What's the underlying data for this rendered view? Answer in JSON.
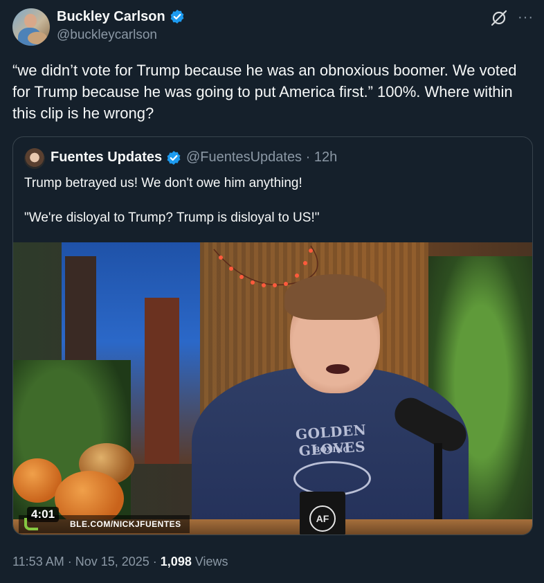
{
  "author": {
    "name": "Buckley Carlson",
    "handle": "@buckleycarlson",
    "verified": true
  },
  "icons": {
    "verified": "verified-badge-icon",
    "grok": "grok-icon",
    "more": "more-options-icon"
  },
  "more_glyph": "···",
  "colors": {
    "background": "#15202b",
    "text": "#f7f9f9",
    "secondary_text": "#8b98a5",
    "verified_blue": "#1d9bf0",
    "border": "#38444d"
  },
  "tweet_text": "“we didn’t vote for Trump because he was an obnoxious boomer. We voted for Trump because he was going to put America first.” 100%. Where within this clip is he wrong?",
  "quote": {
    "name": "Fuentes Updates",
    "handle_time": "@FuentesUpdates · 12h",
    "verified": true,
    "text_line1": "Trump betrayed us! We don't owe him anything!",
    "text_line2": "\"We're disloyal to Trump? Trump is disloyal to US!\"",
    "video": {
      "duration": "4:01",
      "watermark": "BLE.COM/NICKJFUENTES",
      "hoodie_text": "GOLDEN GLOVES",
      "hoodie_sub": "BOXING",
      "mug_logo": "AF"
    }
  },
  "meta": {
    "time_date": "11:53 AM · Nov 15, 2025 · ",
    "views_count": "1,098",
    "views_label": " Views"
  }
}
